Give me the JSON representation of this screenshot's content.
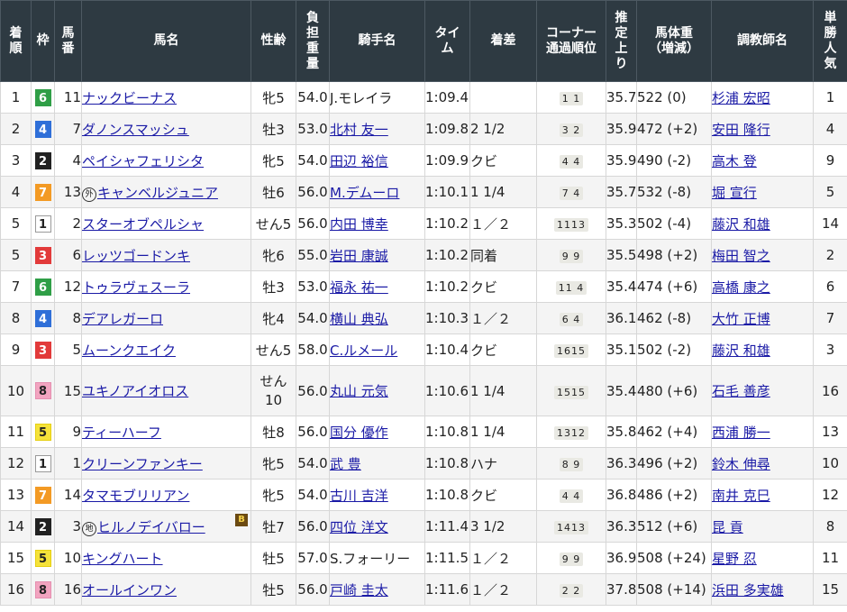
{
  "headers": {
    "rank": [
      "着",
      "順"
    ],
    "waku": [
      "枠"
    ],
    "umaban": [
      "馬",
      "番"
    ],
    "horse": [
      "馬名"
    ],
    "sexage": [
      "性齢"
    ],
    "weight": [
      "負",
      "担",
      "重",
      "量"
    ],
    "jockey": [
      "騎手名"
    ],
    "time": [
      "タイ",
      "ム"
    ],
    "margin": [
      "着差"
    ],
    "corner": [
      "コーナー",
      "通過順位"
    ],
    "last3f": [
      "推",
      "定",
      "上",
      "り"
    ],
    "body": [
      "馬体重",
      "（増減）"
    ],
    "trainer": [
      "調教師名"
    ],
    "pop": [
      "単",
      "勝",
      "人",
      "気"
    ]
  },
  "waku_colors": {
    "1": {
      "bg": "#ffffff",
      "fg": "#222222",
      "border": "#9a9a9a"
    },
    "2": {
      "bg": "#222222",
      "fg": "#ffffff",
      "border": "#222222"
    },
    "3": {
      "bg": "#e23a3a",
      "fg": "#ffffff",
      "border": "#e23a3a"
    },
    "4": {
      "bg": "#2f6fd8",
      "fg": "#ffffff",
      "border": "#2f6fd8"
    },
    "5": {
      "bg": "#f5e23a",
      "fg": "#222222",
      "border": "#e6cf10"
    },
    "6": {
      "bg": "#2f9e46",
      "fg": "#ffffff",
      "border": "#2f9e46"
    },
    "7": {
      "bg": "#f39a24",
      "fg": "#ffffff",
      "border": "#f39a24"
    },
    "8": {
      "bg": "#f2a4c0",
      "fg": "#222222",
      "border": "#e58fb0"
    }
  },
  "rows": [
    {
      "rank": "1",
      "waku": "6",
      "umaban": "11",
      "mark": "",
      "horse": "ナックビーナス",
      "blinker": "",
      "sex": "牝5",
      "sex2": "",
      "weight": "54.0",
      "jockey": "J.モレイラ",
      "jockey_link": false,
      "time": "1:09.4",
      "margin": "",
      "corner": "1 1",
      "last3f": "35.7",
      "body": "522 (0)",
      "trainer": "杉浦 宏昭",
      "pop": "1"
    },
    {
      "rank": "2",
      "waku": "4",
      "umaban": "7",
      "mark": "",
      "horse": "ダノンスマッシュ",
      "blinker": "",
      "sex": "牡3",
      "sex2": "",
      "weight": "53.0",
      "jockey": "北村 友一",
      "jockey_link": true,
      "time": "1:09.8",
      "margin": "2 1/2",
      "corner": "3 2",
      "last3f": "35.9",
      "body": "472 (+2)",
      "trainer": "安田 隆行",
      "pop": "4"
    },
    {
      "rank": "3",
      "waku": "2",
      "umaban": "4",
      "mark": "",
      "horse": "ペイシャフェリシタ",
      "blinker": "",
      "sex": "牝5",
      "sex2": "",
      "weight": "54.0",
      "jockey": "田辺 裕信",
      "jockey_link": true,
      "time": "1:09.9",
      "margin": "クビ",
      "corner": "4 4",
      "last3f": "35.9",
      "body": "490 (-2)",
      "trainer": "高木 登",
      "pop": "9"
    },
    {
      "rank": "4",
      "waku": "7",
      "umaban": "13",
      "mark": "外",
      "horse": "キャンベルジュニア",
      "blinker": "",
      "sex": "牡6",
      "sex2": "",
      "weight": "56.0",
      "jockey": "M.デムーロ",
      "jockey_link": true,
      "time": "1:10.1",
      "margin": "1 1/4",
      "corner": "7 4",
      "last3f": "35.7",
      "body": "532 (-8)",
      "trainer": "堀 宣行",
      "pop": "5"
    },
    {
      "rank": "5",
      "waku": "1",
      "umaban": "2",
      "mark": "",
      "horse": "スターオブペルシャ",
      "blinker": "",
      "sex": "せん5",
      "sex2": "",
      "weight": "56.0",
      "jockey": "内田 博幸",
      "jockey_link": true,
      "time": "1:10.2",
      "margin": "１／２",
      "corner": "1113",
      "last3f": "35.3",
      "body": "502 (-4)",
      "trainer": "藤沢 和雄",
      "pop": "14"
    },
    {
      "rank": "5",
      "waku": "3",
      "umaban": "6",
      "mark": "",
      "horse": "レッツゴードンキ",
      "blinker": "",
      "sex": "牝6",
      "sex2": "",
      "weight": "55.0",
      "jockey": "岩田 康誠",
      "jockey_link": true,
      "time": "1:10.2",
      "margin": "同着",
      "corner": "9 9",
      "last3f": "35.5",
      "body": "498 (+2)",
      "trainer": "梅田 智之",
      "pop": "2"
    },
    {
      "rank": "7",
      "waku": "6",
      "umaban": "12",
      "mark": "",
      "horse": "トゥラヴェスーラ",
      "blinker": "",
      "sex": "牡3",
      "sex2": "",
      "weight": "53.0",
      "jockey": "福永 祐一",
      "jockey_link": true,
      "time": "1:10.2",
      "margin": "クビ",
      "corner": "11 4",
      "last3f": "35.4",
      "body": "474 (+6)",
      "trainer": "高橋 康之",
      "pop": "6"
    },
    {
      "rank": "8",
      "waku": "4",
      "umaban": "8",
      "mark": "",
      "horse": "デアレガーロ",
      "blinker": "",
      "sex": "牝4",
      "sex2": "",
      "weight": "54.0",
      "jockey": "横山 典弘",
      "jockey_link": true,
      "time": "1:10.3",
      "margin": "１／２",
      "corner": "6 4",
      "last3f": "36.1",
      "body": "462 (-8)",
      "trainer": "大竹 正博",
      "pop": "7"
    },
    {
      "rank": "9",
      "waku": "3",
      "umaban": "5",
      "mark": "",
      "horse": "ムーンクエイク",
      "blinker": "",
      "sex": "せん5",
      "sex2": "",
      "weight": "58.0",
      "jockey": "C.ルメール",
      "jockey_link": true,
      "time": "1:10.4",
      "margin": "クビ",
      "corner": "1615",
      "last3f": "35.1",
      "body": "502 (-2)",
      "trainer": "藤沢 和雄",
      "pop": "3"
    },
    {
      "rank": "10",
      "waku": "8",
      "umaban": "15",
      "mark": "",
      "horse": "ユキノアイオロス",
      "blinker": "",
      "sex": "せん",
      "sex2": "10",
      "weight": "56.0",
      "jockey": "丸山 元気",
      "jockey_link": true,
      "time": "1:10.6",
      "margin": "1 1/4",
      "corner": "1515",
      "last3f": "35.4",
      "body": "480 (+6)",
      "trainer": "石毛 善彦",
      "pop": "16"
    },
    {
      "rank": "11",
      "waku": "5",
      "umaban": "9",
      "mark": "",
      "horse": "ティーハーフ",
      "blinker": "",
      "sex": "牡8",
      "sex2": "",
      "weight": "56.0",
      "jockey": "国分 優作",
      "jockey_link": true,
      "time": "1:10.8",
      "margin": "1 1/4",
      "corner": "1312",
      "last3f": "35.8",
      "body": "462 (+4)",
      "trainer": "西浦 勝一",
      "pop": "13"
    },
    {
      "rank": "12",
      "waku": "1",
      "umaban": "1",
      "mark": "",
      "horse": "クリーンファンキー",
      "blinker": "",
      "sex": "牝5",
      "sex2": "",
      "weight": "54.0",
      "jockey": "武 豊",
      "jockey_link": true,
      "time": "1:10.8",
      "margin": "ハナ",
      "corner": "8 9",
      "last3f": "36.3",
      "body": "496 (+2)",
      "trainer": "鈴木 伸尋",
      "pop": "10"
    },
    {
      "rank": "13",
      "waku": "7",
      "umaban": "14",
      "mark": "",
      "horse": "タマモブリリアン",
      "blinker": "",
      "sex": "牝5",
      "sex2": "",
      "weight": "54.0",
      "jockey": "古川 吉洋",
      "jockey_link": true,
      "time": "1:10.8",
      "margin": "クビ",
      "corner": "4 4",
      "last3f": "36.8",
      "body": "486 (+2)",
      "trainer": "南井 克巳",
      "pop": "12"
    },
    {
      "rank": "14",
      "waku": "2",
      "umaban": "3",
      "mark": "地",
      "horse": "ヒルノデイバロー",
      "blinker": "B",
      "sex": "牡7",
      "sex2": "",
      "weight": "56.0",
      "jockey": "四位 洋文",
      "jockey_link": true,
      "time": "1:11.4",
      "margin": "3 1/2",
      "corner": "1413",
      "last3f": "36.3",
      "body": "512 (+6)",
      "trainer": "昆 貢",
      "pop": "8"
    },
    {
      "rank": "15",
      "waku": "5",
      "umaban": "10",
      "mark": "",
      "horse": "キングハート",
      "blinker": "",
      "sex": "牡5",
      "sex2": "",
      "weight": "57.0",
      "jockey": "S.フォーリー",
      "jockey_link": false,
      "time": "1:11.5",
      "margin": "１／２",
      "corner": "9 9",
      "last3f": "36.9",
      "body": "508 (+24)",
      "trainer": "星野 忍",
      "pop": "11"
    },
    {
      "rank": "16",
      "waku": "8",
      "umaban": "16",
      "mark": "",
      "horse": "オールインワン",
      "blinker": "",
      "sex": "牡5",
      "sex2": "",
      "weight": "56.0",
      "jockey": "戸崎 圭太",
      "jockey_link": true,
      "time": "1:11.6",
      "margin": "１／２",
      "corner": "2 2",
      "last3f": "37.8",
      "body": "508 (+14)",
      "trainer": "浜田 多実雄",
      "pop": "15"
    }
  ]
}
